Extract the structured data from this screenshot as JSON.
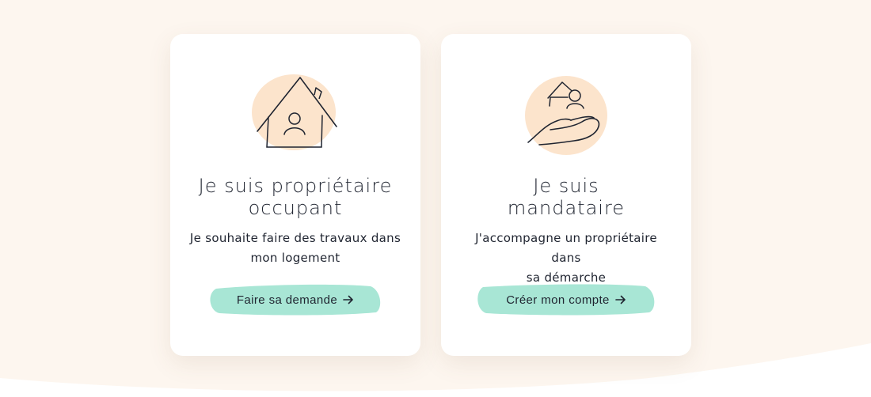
{
  "colors": {
    "page_background": "#fdf6ef",
    "card_background": "#ffffff",
    "illustration_blob": "#fce4cc",
    "cta_brush": "#a8e6d5",
    "text": "#1f2430"
  },
  "cards": [
    {
      "icon": "house-person-icon",
      "title_line1": "Je suis propriétaire",
      "title_line2": "occupant",
      "desc_line1": "Je souhaite faire des travaux dans",
      "desc_line2": "mon logement",
      "cta_label": "Faire sa demande",
      "cta_icon": "arrow-right-icon"
    },
    {
      "icon": "hand-house-person-icon",
      "title_line1": "Je suis",
      "title_line2": "mandataire",
      "desc_line1": "J'accompagne un propriétaire dans",
      "desc_line2": "sa démarche",
      "cta_label": "Créer mon compte",
      "cta_icon": "arrow-right-icon"
    }
  ]
}
